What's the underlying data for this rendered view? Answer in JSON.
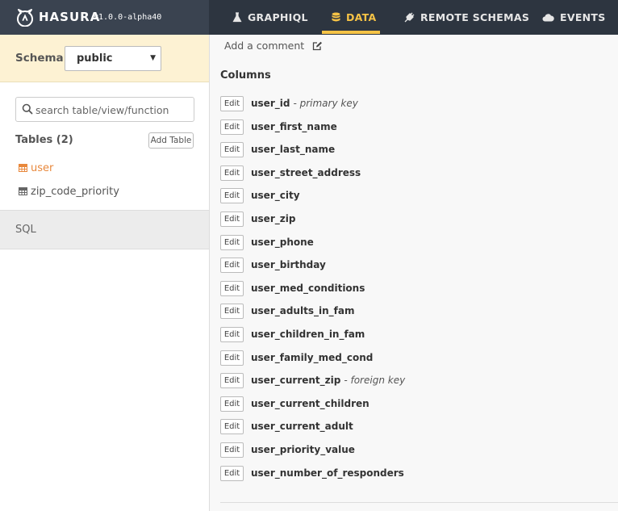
{
  "brand": {
    "name": "HASURA",
    "version": "v1.0.0-alpha40"
  },
  "nav": {
    "items": [
      {
        "label": "GRAPHIQL",
        "icon": "flask-icon",
        "active": false
      },
      {
        "label": "DATA",
        "icon": "database-icon",
        "active": true
      },
      {
        "label": "REMOTE SCHEMAS",
        "icon": "plug-icon",
        "active": false
      },
      {
        "label": "EVENTS",
        "icon": "cloud-icon",
        "active": false
      }
    ]
  },
  "sidebar": {
    "schema_label": "Schema:",
    "schema_value": "public",
    "search_placeholder": "search table/view/function",
    "tables_title": "Tables (2)",
    "add_table_label": "Add Table",
    "tables": [
      {
        "name": "user",
        "active": true
      },
      {
        "name": "zip_code_priority",
        "active": false
      }
    ],
    "sql_label": "SQL"
  },
  "main": {
    "comment_label": "Add a comment",
    "columns_title": "Columns",
    "edit_label": "Edit",
    "columns": [
      {
        "name": "user_id",
        "note": "- primary key"
      },
      {
        "name": "user_first_name",
        "note": ""
      },
      {
        "name": "user_last_name",
        "note": ""
      },
      {
        "name": "user_street_address",
        "note": ""
      },
      {
        "name": "user_city",
        "note": ""
      },
      {
        "name": "user_zip",
        "note": ""
      },
      {
        "name": "user_phone",
        "note": ""
      },
      {
        "name": "user_birthday",
        "note": ""
      },
      {
        "name": "user_med_conditions",
        "note": ""
      },
      {
        "name": "user_adults_in_fam",
        "note": ""
      },
      {
        "name": "user_children_in_fam",
        "note": ""
      },
      {
        "name": "user_family_med_cond",
        "note": ""
      },
      {
        "name": "user_current_zip",
        "note": "- foreign key"
      },
      {
        "name": "user_current_children",
        "note": ""
      },
      {
        "name": "user_current_adult",
        "note": ""
      },
      {
        "name": "user_priority_value",
        "note": ""
      },
      {
        "name": "user_number_of_responders",
        "note": ""
      }
    ]
  },
  "colors": {
    "topbar": "#2d3540",
    "accent": "#f6c346",
    "active_table": "#e8883c",
    "schema_bar": "#fdf2d3"
  }
}
